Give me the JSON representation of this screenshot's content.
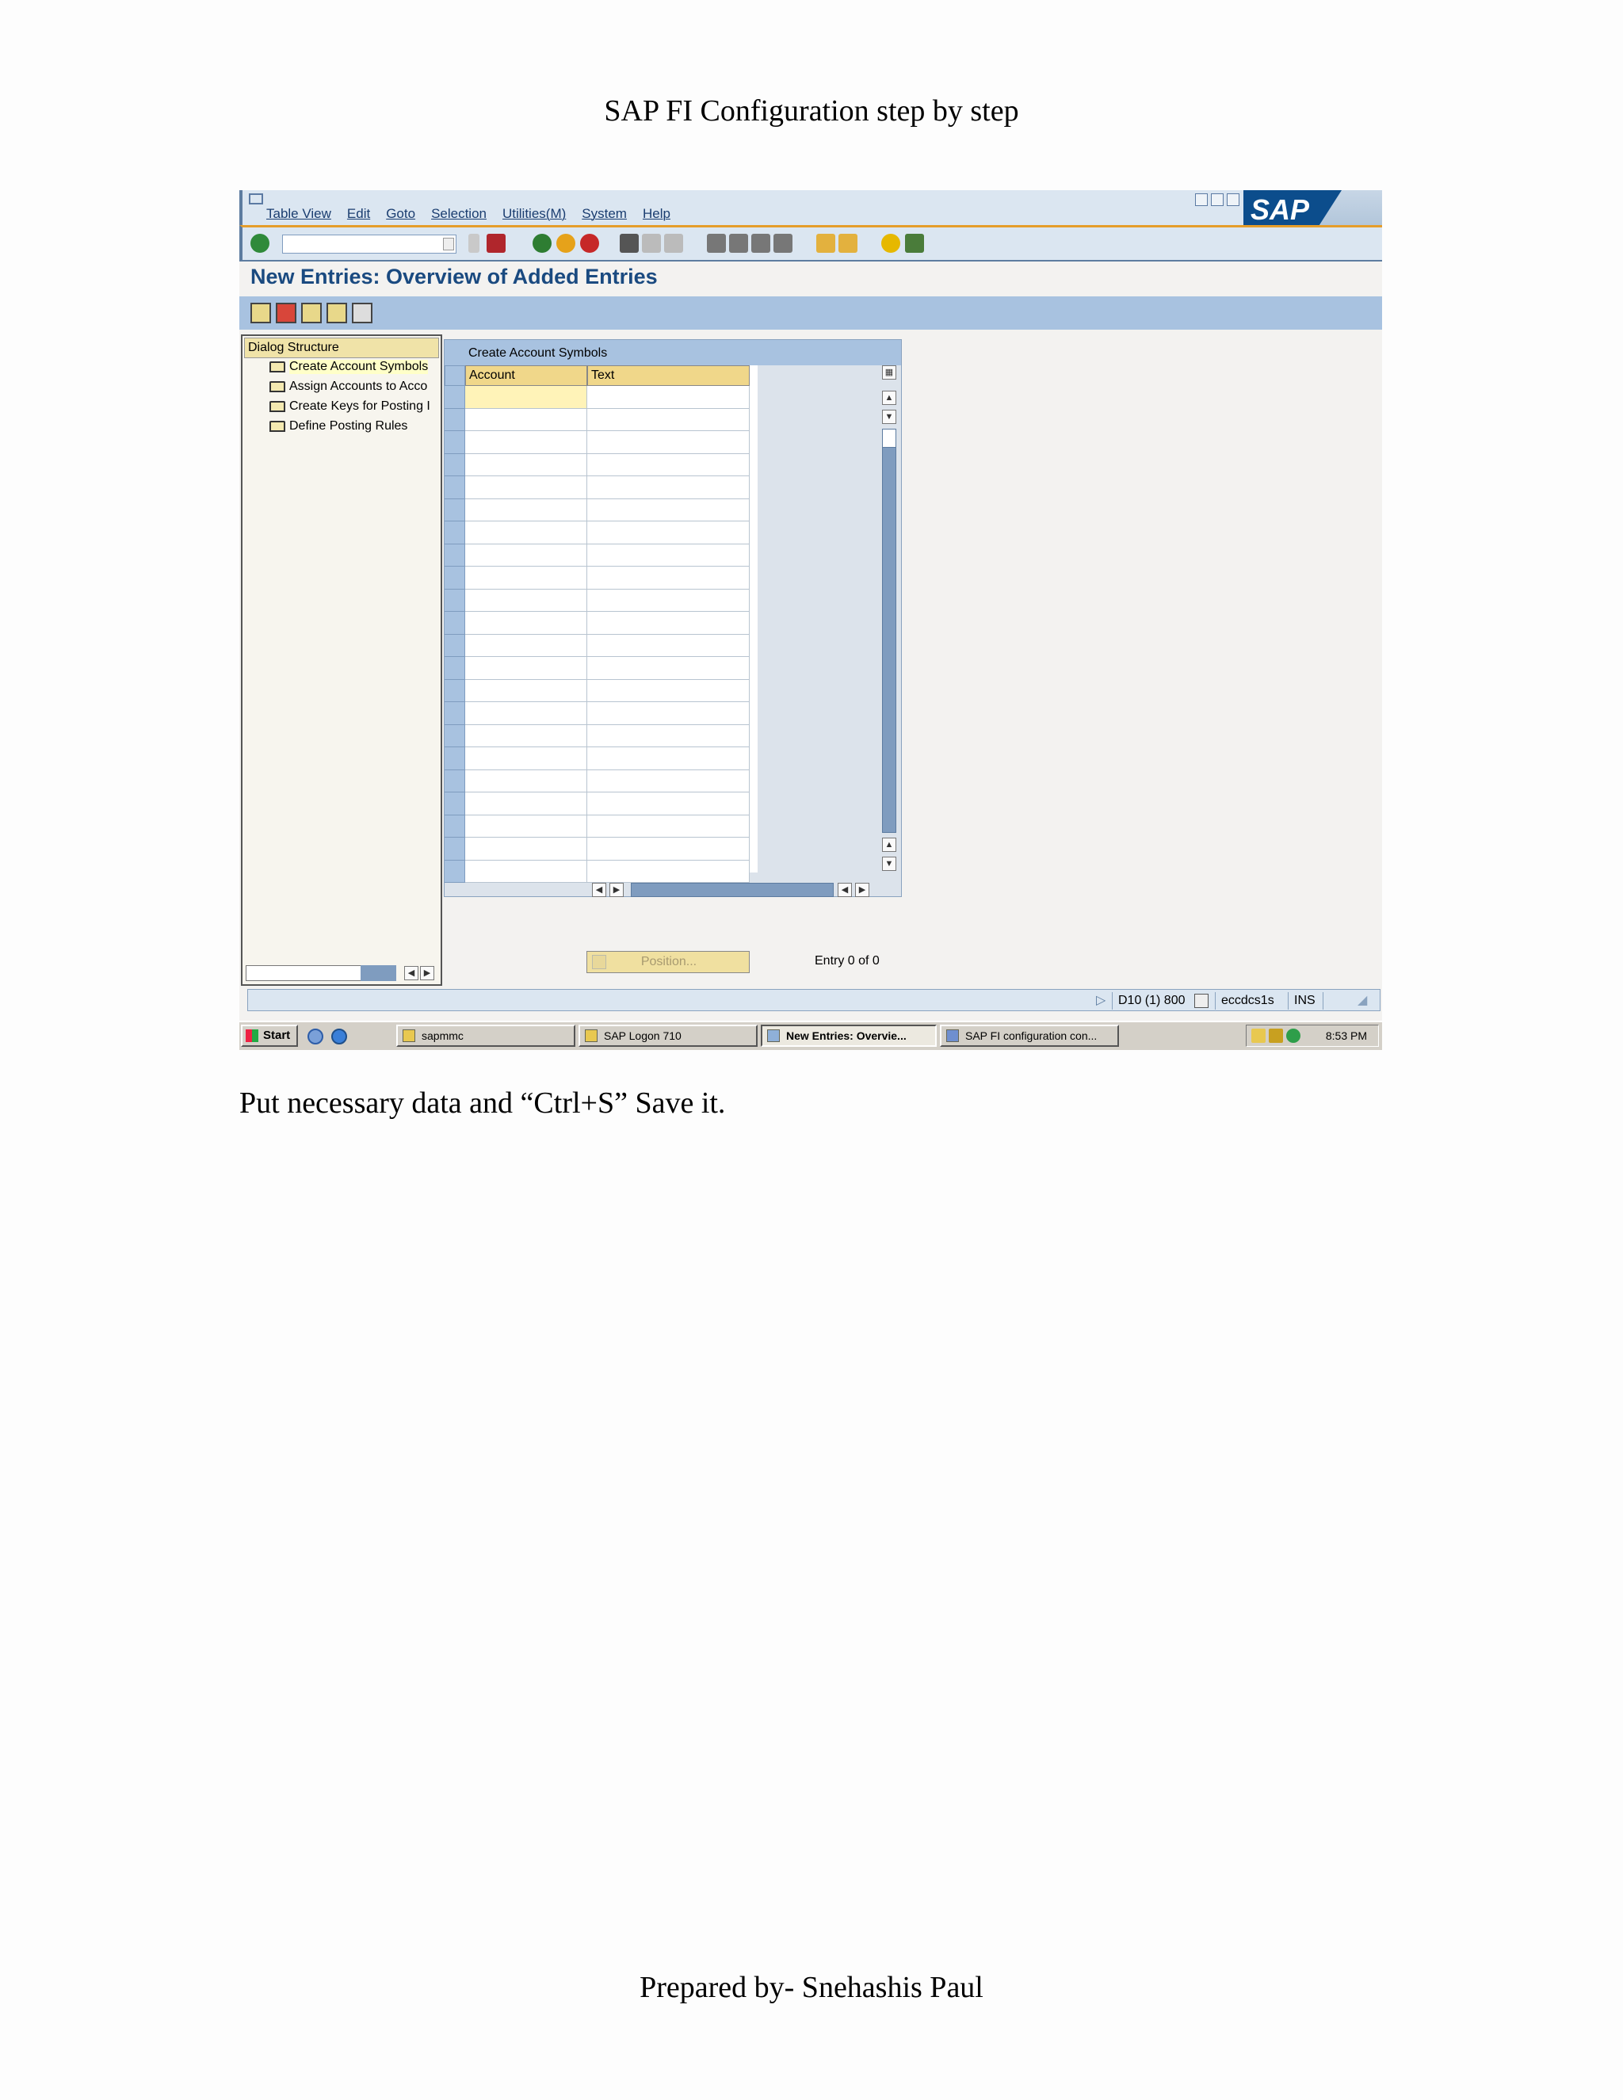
{
  "doc": {
    "header": "SAP FI Configuration step by step",
    "instruction": "Put necessary data and “Ctrl+S” Save it.",
    "footer": "Prepared by- Snehashis Paul"
  },
  "sap": {
    "menu": [
      "Table View",
      "Edit",
      "Goto",
      "Selection",
      "Utilities(M)",
      "System",
      "Help"
    ],
    "logo": "SAP",
    "title": "New Entries: Overview of Added Entries",
    "dialog_structure": {
      "header": "Dialog Structure",
      "items": [
        {
          "label": "Create Account Symbols",
          "selected": true
        },
        {
          "label": "Assign Accounts to Acco",
          "selected": false
        },
        {
          "label": "Create Keys for Posting I",
          "selected": false
        },
        {
          "label": "Define Posting Rules",
          "selected": false
        }
      ]
    },
    "table": {
      "title": "Create Account Symbols",
      "columns": [
        "Account",
        "Text"
      ],
      "rows": 22
    },
    "position_button": "Position...",
    "entry_info": "Entry 0 of 0",
    "status": {
      "system": "D10 (1) 800",
      "server": "eccdcs1s",
      "mode": "INS"
    }
  },
  "taskbar": {
    "start": "Start",
    "tasks": [
      "sapmmc",
      "SAP Logon 710",
      "New Entries: Overvie...",
      "SAP FI configuration con..."
    ],
    "active_task": "New Entries: Overvie...",
    "clock": "8:53 PM"
  }
}
